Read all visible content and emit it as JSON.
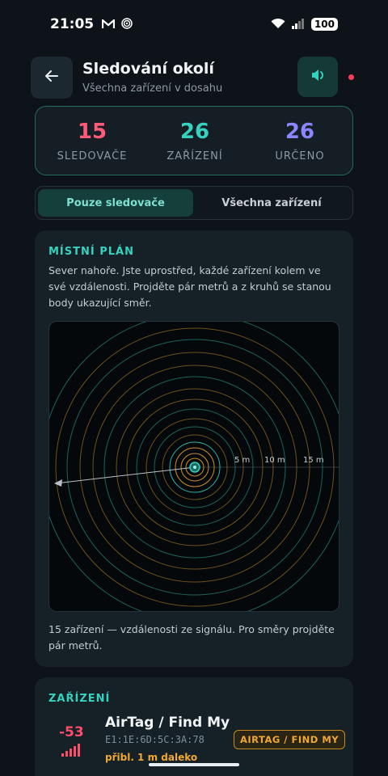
{
  "status_bar": {
    "time": "21:05",
    "left_icons": [
      "gmail-icon",
      "hotspot-icon"
    ],
    "right_icons": [
      "wifi-icon",
      "cellular-signal-icon"
    ],
    "battery": "100"
  },
  "header": {
    "title": "Sledování okolí",
    "subtitle": "Všechna zařízení v dosahu",
    "back_icon": "arrow-left-icon",
    "sound_icon": "speaker-icon"
  },
  "stats": [
    {
      "value": "15",
      "label": "SLEDOVAČE",
      "color": "#ff5a78"
    },
    {
      "value": "26",
      "label": "ZAŘÍZENÍ",
      "color": "#35d2c0"
    },
    {
      "value": "26",
      "label": "URČENO",
      "color": "#8b86ff"
    }
  ],
  "filter": {
    "active": "Pouze sledovače",
    "inactive": "Všechna zařízení"
  },
  "map": {
    "title": "MÍSTNÍ PLÁN",
    "description": "Sever nahoře. Jste uprostřed, každé zařízení kolem ve své vzdálenosti. Projděte pár metrů a z kruhů se stanou body ukazující směr.",
    "scale_labels": [
      "5 m",
      "10 m",
      "15 m"
    ],
    "footer": "15 zařízení — vzdálenosti ze signálu. Pro směry projděte pár metrů."
  },
  "devices": {
    "title": "ZAŘÍZENÍ",
    "items": [
      {
        "rssi": "-53",
        "name": "AirTag / Find My",
        "mac": "E1:1E:6D:5C:3A:78",
        "badge": "AIRTAG / FIND MY",
        "distance": "přibl. 1 m daleko"
      }
    ]
  },
  "colors": {
    "accent": "#35d2c0",
    "tracker_ring": "#f0a830",
    "device_ring": "#35d2c0",
    "danger": "#ff4d6a"
  }
}
